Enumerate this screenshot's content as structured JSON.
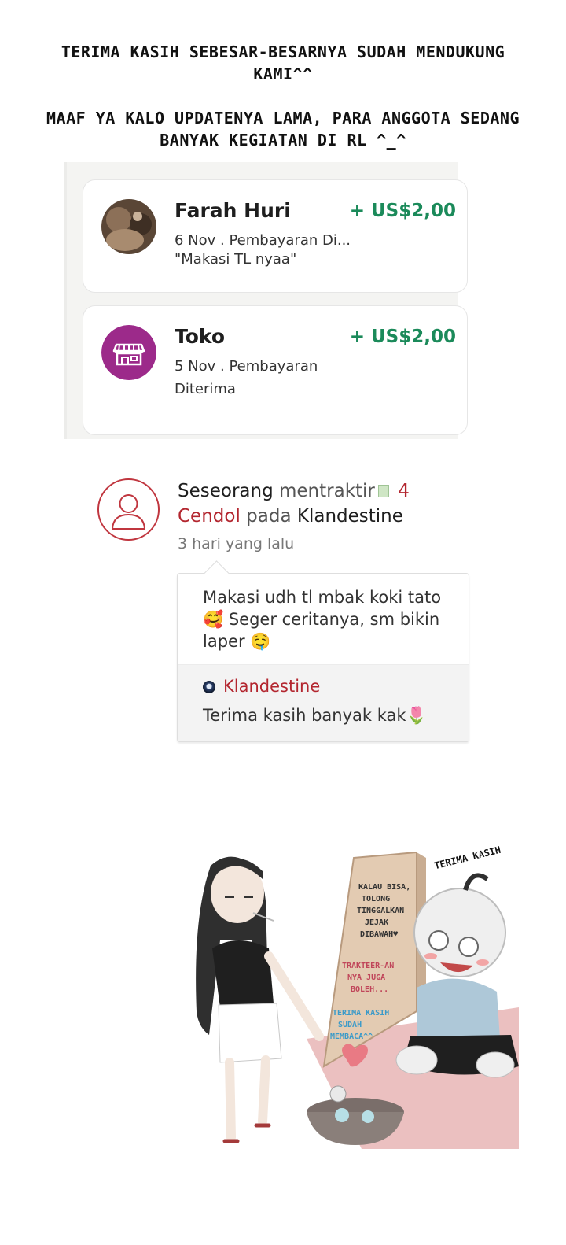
{
  "header": {
    "line1": "TERIMA KASIH SEBESAR-BESARNYA SUDAH MENDUKUNG KAMI^^",
    "line2": "MAAF YA KALO UPDATENYA LAMA, PARA ANGGOTA SEDANG BANYAK KEGIATAN DI RL ^_^"
  },
  "payments": [
    {
      "name": "Farah Huri",
      "amount": "+ US$2,00",
      "meta": "6 Nov . Pembayaran Di...",
      "note": "\"Makasi TL nyaa\""
    },
    {
      "name": "Toko",
      "amount": "+ US$2,00",
      "meta": "5 Nov . Pembayaran Diterima",
      "note": ""
    }
  ],
  "notification": {
    "actor": "Seseorang",
    "action": "mentraktir",
    "count": "4",
    "item": "Cendol",
    "preposition": "pada",
    "target": "Klandestine",
    "time": "3 hari yang lalu",
    "message": "Makasi udh tl mbak koki tato 🥰 Seger ceritanya, sm bikin laper 🤤",
    "reply_author": "Klandestine",
    "reply_text": "Terima kasih banyak kak🌷"
  },
  "illustration": {
    "sign_top": "TERIMA KASIH",
    "board_text1": "KALAU BISA, TOLONG TINGGALKAN JEJAK DIBAWAH♥",
    "board_text2": "TRAKTEER-AN NYA JUGA BOLEH...",
    "board_text3": "TERIMA KASIH SUDAH MEMBACA^^"
  },
  "colors": {
    "amount_green": "#1b8a5a",
    "brand_red": "#b3262f",
    "toko_purple": "#9c2a8a"
  }
}
